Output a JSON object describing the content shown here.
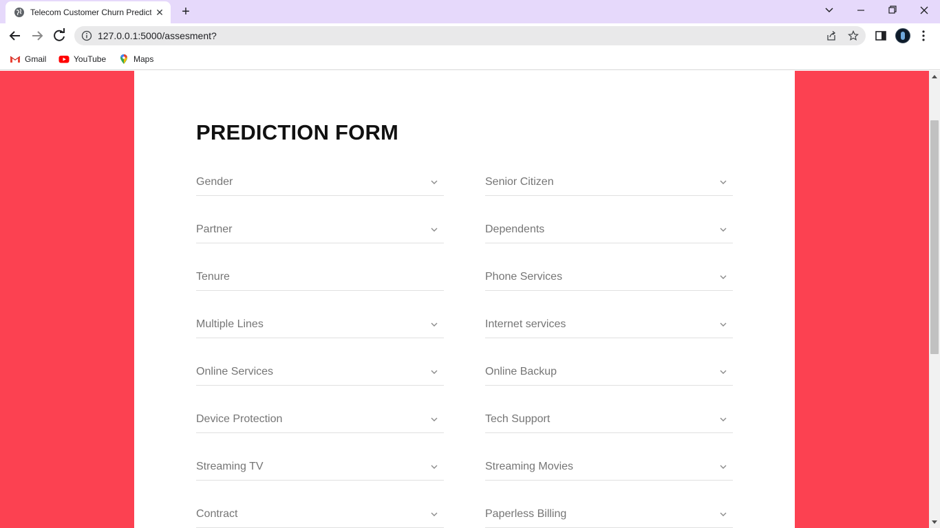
{
  "browser": {
    "tab_title": "Telecom Customer Churn Prediction",
    "tab_title_visible": "Telecom Customer Churn Predict",
    "url": "127.0.0.1:5000/assesment?",
    "bookmarks": [
      {
        "label": "Gmail",
        "icon": "gmail-icon"
      },
      {
        "label": "YouTube",
        "icon": "youtube-icon"
      },
      {
        "label": "Maps",
        "icon": "maps-icon"
      }
    ]
  },
  "form": {
    "title": "PREDICTION FORM",
    "fields": [
      {
        "label": "Gender",
        "type": "select"
      },
      {
        "label": "Senior Citizen",
        "type": "select"
      },
      {
        "label": "Partner",
        "type": "select"
      },
      {
        "label": "Dependents",
        "type": "select"
      },
      {
        "label": "Tenure",
        "type": "input"
      },
      {
        "label": "Phone Services",
        "type": "select"
      },
      {
        "label": "Multiple Lines",
        "type": "select"
      },
      {
        "label": "Internet services",
        "type": "select"
      },
      {
        "label": "Online Services",
        "type": "select"
      },
      {
        "label": "Online Backup",
        "type": "select"
      },
      {
        "label": "Device Protection",
        "type": "select"
      },
      {
        "label": "Tech Support",
        "type": "select"
      },
      {
        "label": "Streaming TV",
        "type": "select"
      },
      {
        "label": "Streaming Movies",
        "type": "select"
      },
      {
        "label": "Contract",
        "type": "select"
      },
      {
        "label": "Paperless Billing",
        "type": "select"
      }
    ]
  },
  "colors": {
    "page_background": "#fc4151",
    "card_background": "#ffffff",
    "titlebar": "#e6d9fb"
  }
}
